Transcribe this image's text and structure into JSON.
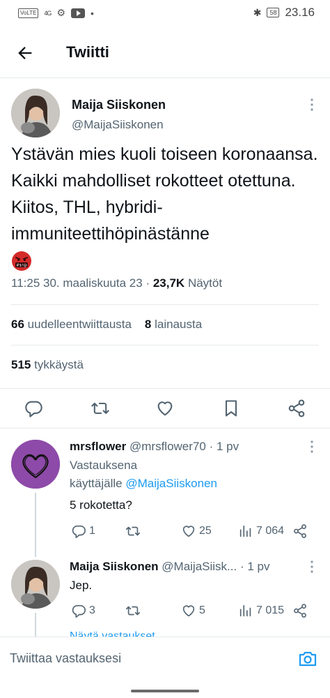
{
  "status_bar": {
    "volte": "VoLTE",
    "network": "4G",
    "battery": "58",
    "time": "23.16"
  },
  "header": {
    "title": "Twiitti"
  },
  "tweet": {
    "author_name": "Maija Siiskonen",
    "author_handle": "@MaijaSiiskonen",
    "text": "Ystävän mies kuoli toiseen koronaansa. Kaikki mahdolliset rokotteet otettuna. Kiitos, THL, hybridi-immuniteettihöpinästänne",
    "emoji": "face-with-symbols-on-mouth",
    "time": "11:25 30. maaliskuuta 23",
    "separator": "·",
    "views_count": "23,7K",
    "views_label": "Näytöt",
    "retweets_count": "66",
    "retweets_label": "uudelleentwiittausta",
    "quotes_count": "8",
    "quotes_label": "lainausta",
    "likes_count": "515",
    "likes_label": "tykkäystä"
  },
  "replies": [
    {
      "name": "mrsflower",
      "handle": "@mrsflower70",
      "time": "· 1 pv",
      "reply_prefix_1": "Vastauksena",
      "reply_prefix_2": "käyttäjälle",
      "mention": "@MaijaSiiskonen",
      "text": "5 rokotetta?",
      "replies": "1",
      "retweets": "",
      "likes": "25",
      "views": "7 064"
    },
    {
      "name": "Maija Siiskonen",
      "handle": "@MaijaSiisk...",
      "time": "· 1 pv",
      "text": "Jep.",
      "replies": "3",
      "retweets": "",
      "likes": "5",
      "views": "7 015"
    }
  ],
  "show_more": "Näytä vastaukset",
  "compose": {
    "placeholder": "Twiittaa vastauksesi"
  },
  "colors": {
    "accent": "#1d9bf0",
    "text": "#0f1419",
    "muted": "#536471",
    "divider": "#e6e9eb",
    "avatar_purple": "#8e4aa8"
  }
}
